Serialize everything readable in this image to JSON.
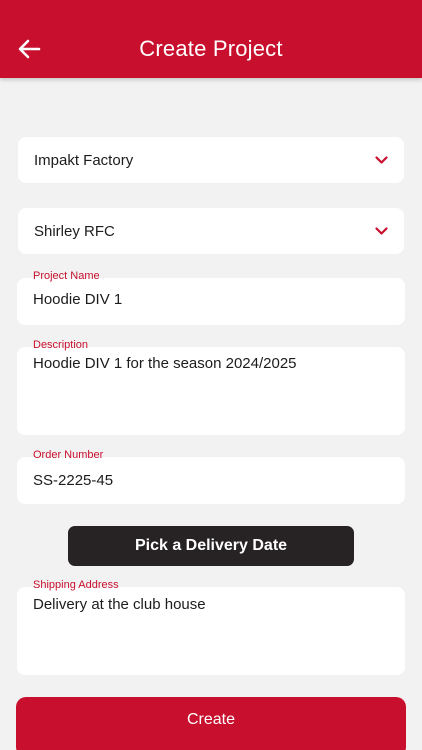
{
  "header": {
    "title": "Create Project",
    "back_icon": "arrow-left-icon"
  },
  "form": {
    "factory_select": {
      "value": "Impakt Factory",
      "icon": "chevron-down-icon"
    },
    "club_select": {
      "value": "Shirley RFC",
      "icon": "chevron-down-icon"
    },
    "project_name": {
      "label": "Project Name",
      "value": "Hoodie DIV 1"
    },
    "description": {
      "label": "Description",
      "value": "Hoodie DIV 1 for the season 2024/2025"
    },
    "order_number": {
      "label": "Order Number",
      "value": "SS-2225-45"
    },
    "delivery_date_button": "Pick a Delivery Date",
    "shipping_address": {
      "label": "Shipping Address",
      "value": "Delivery at the club house"
    },
    "create_button": "Create"
  },
  "colors": {
    "accent": "#c8102e",
    "background": "#f2f2f2",
    "dark_button": "#272324"
  }
}
